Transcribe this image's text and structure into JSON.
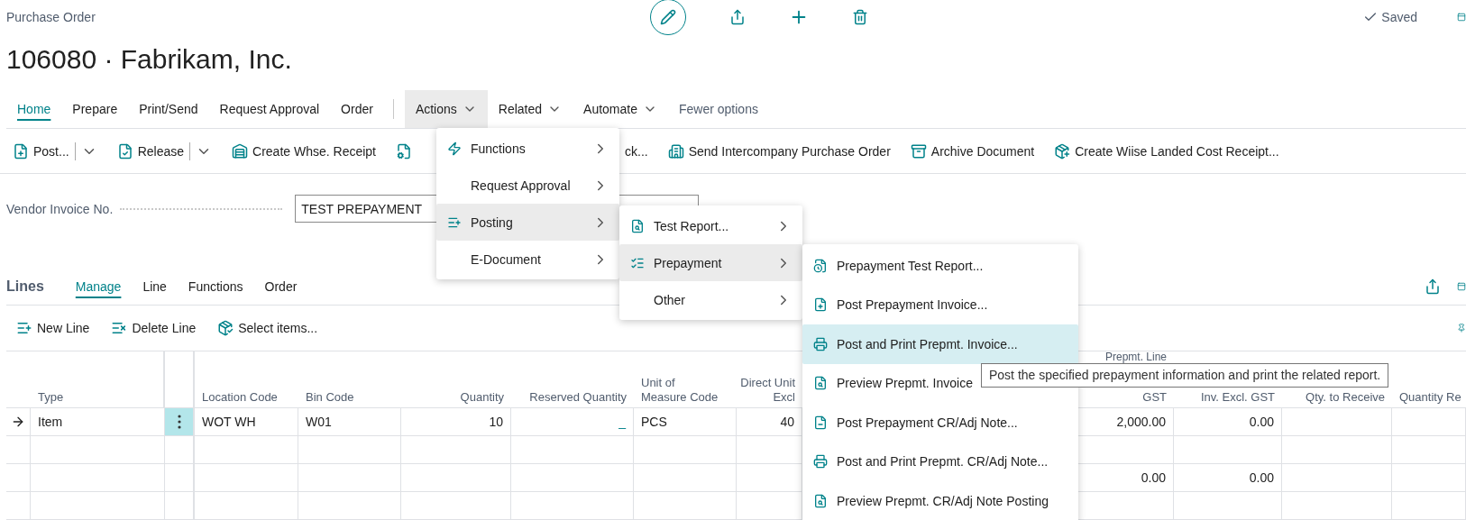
{
  "page_label": "Purchase Order",
  "title": "106080 · Fabrikam, Inc.",
  "status": "Saved",
  "tabs": [
    {
      "kind": "tab",
      "label": "Home",
      "selected": true
    },
    {
      "kind": "tab",
      "label": "Prepare",
      "selected": false
    },
    {
      "kind": "tab",
      "label": "Print/Send",
      "selected": false
    },
    {
      "kind": "tab",
      "label": "Request Approval",
      "selected": false
    },
    {
      "kind": "tab",
      "label": "Order",
      "selected": false
    },
    {
      "kind": "menu",
      "label": "Actions",
      "selected": false,
      "expanded": true
    },
    {
      "kind": "menu",
      "label": "Related",
      "selected": false,
      "expanded": false
    },
    {
      "kind": "menu",
      "label": "Automate",
      "selected": false,
      "expanded": false
    },
    {
      "kind": "link",
      "label": "Fewer options",
      "selected": false
    }
  ],
  "toolbar": [
    {
      "kind": "split",
      "label": "Post..."
    },
    {
      "kind": "split",
      "label": "Release"
    },
    {
      "kind": "button",
      "label": "Create Whse. Receipt"
    },
    {
      "kind": "icon"
    },
    {
      "kind": "text",
      "label": "ck..."
    },
    {
      "kind": "button",
      "label": "Send Intercompany Purchase Order"
    },
    {
      "kind": "button",
      "label": "Archive Document"
    },
    {
      "kind": "button",
      "label": "Create Wiise Landed Cost Receipt..."
    }
  ],
  "fields": [
    {
      "label": "Vendor Invoice No.",
      "value": "TEST PREPAYMENT"
    }
  ],
  "lines": {
    "title": "Lines",
    "tabs": [
      {
        "label": "Manage",
        "selected": true
      },
      {
        "label": "Line",
        "selected": false
      },
      {
        "label": "Functions",
        "selected": false
      },
      {
        "label": "Order",
        "selected": false
      }
    ],
    "actions": [
      "New Line",
      "Delete Line",
      "Select items..."
    ],
    "columns": [
      {
        "label": [
          "Type"
        ],
        "kind": "plain"
      },
      {
        "label": [
          "Location Code"
        ],
        "kind": "plain"
      },
      {
        "label": [
          "Bin Code"
        ],
        "kind": "plain"
      },
      {
        "label": [
          "Quantity"
        ],
        "kind": "plain"
      },
      {
        "label": [
          "Reserved Quantity"
        ],
        "kind": "link"
      },
      {
        "label": [
          "Unit of",
          "Measure Code"
        ],
        "kind": "plain"
      },
      {
        "label": [
          "Direct Unit",
          "Excl"
        ],
        "kind": "plain"
      },
      {
        "label": [
          "Prepmt. Line",
          "GST"
        ],
        "kind": "split"
      },
      {
        "label": [
          "Inv. Excl. GST"
        ],
        "kind": "plain"
      },
      {
        "label": [
          "Qty. to Receive"
        ],
        "kind": "plain"
      },
      {
        "label": [
          "Quantity Re"
        ],
        "kind": "plain"
      }
    ],
    "rows": [
      {
        "selected": true,
        "cells": [
          "Item",
          "WOT WH",
          "W01",
          "10",
          "_",
          "PCS",
          "40",
          "2,000.00",
          "0.00",
          null,
          null
        ]
      },
      {
        "selected": false
      },
      {
        "selected": false,
        "cells": [
          null,
          null,
          null,
          null,
          null,
          null,
          null,
          "0.00",
          "0.00",
          null,
          null
        ]
      },
      {
        "selected": false
      }
    ]
  },
  "menus": {
    "actions": [
      {
        "label": "Functions",
        "selected": false
      },
      {
        "label": "Request Approval",
        "selected": false
      },
      {
        "label": "Posting",
        "selected": true
      },
      {
        "label": "E-Document",
        "selected": false
      }
    ],
    "posting": [
      {
        "label": "Test Report...",
        "selected": false
      },
      {
        "label": "Prepayment",
        "selected": true
      },
      {
        "label": "Other",
        "selected": false
      }
    ],
    "prepayment": [
      {
        "label": "Prepayment Test Report...",
        "selected": false
      },
      {
        "label": "Post Prepayment Invoice...",
        "selected": false
      },
      {
        "label": "Post and Print Prepmt. Invoice...",
        "selected": true
      },
      {
        "label": "Preview Prepmt. Invoice",
        "selected": false
      },
      {
        "label": "Post Prepayment CR/Adj Note...",
        "selected": false
      },
      {
        "label": "Post and Print Prepmt. CR/Adj Note...",
        "selected": false
      },
      {
        "label": "Preview Prepmt. CR/Adj Note Posting",
        "selected": false
      }
    ]
  },
  "tooltip": "Post the specified prepayment information and print the related report."
}
